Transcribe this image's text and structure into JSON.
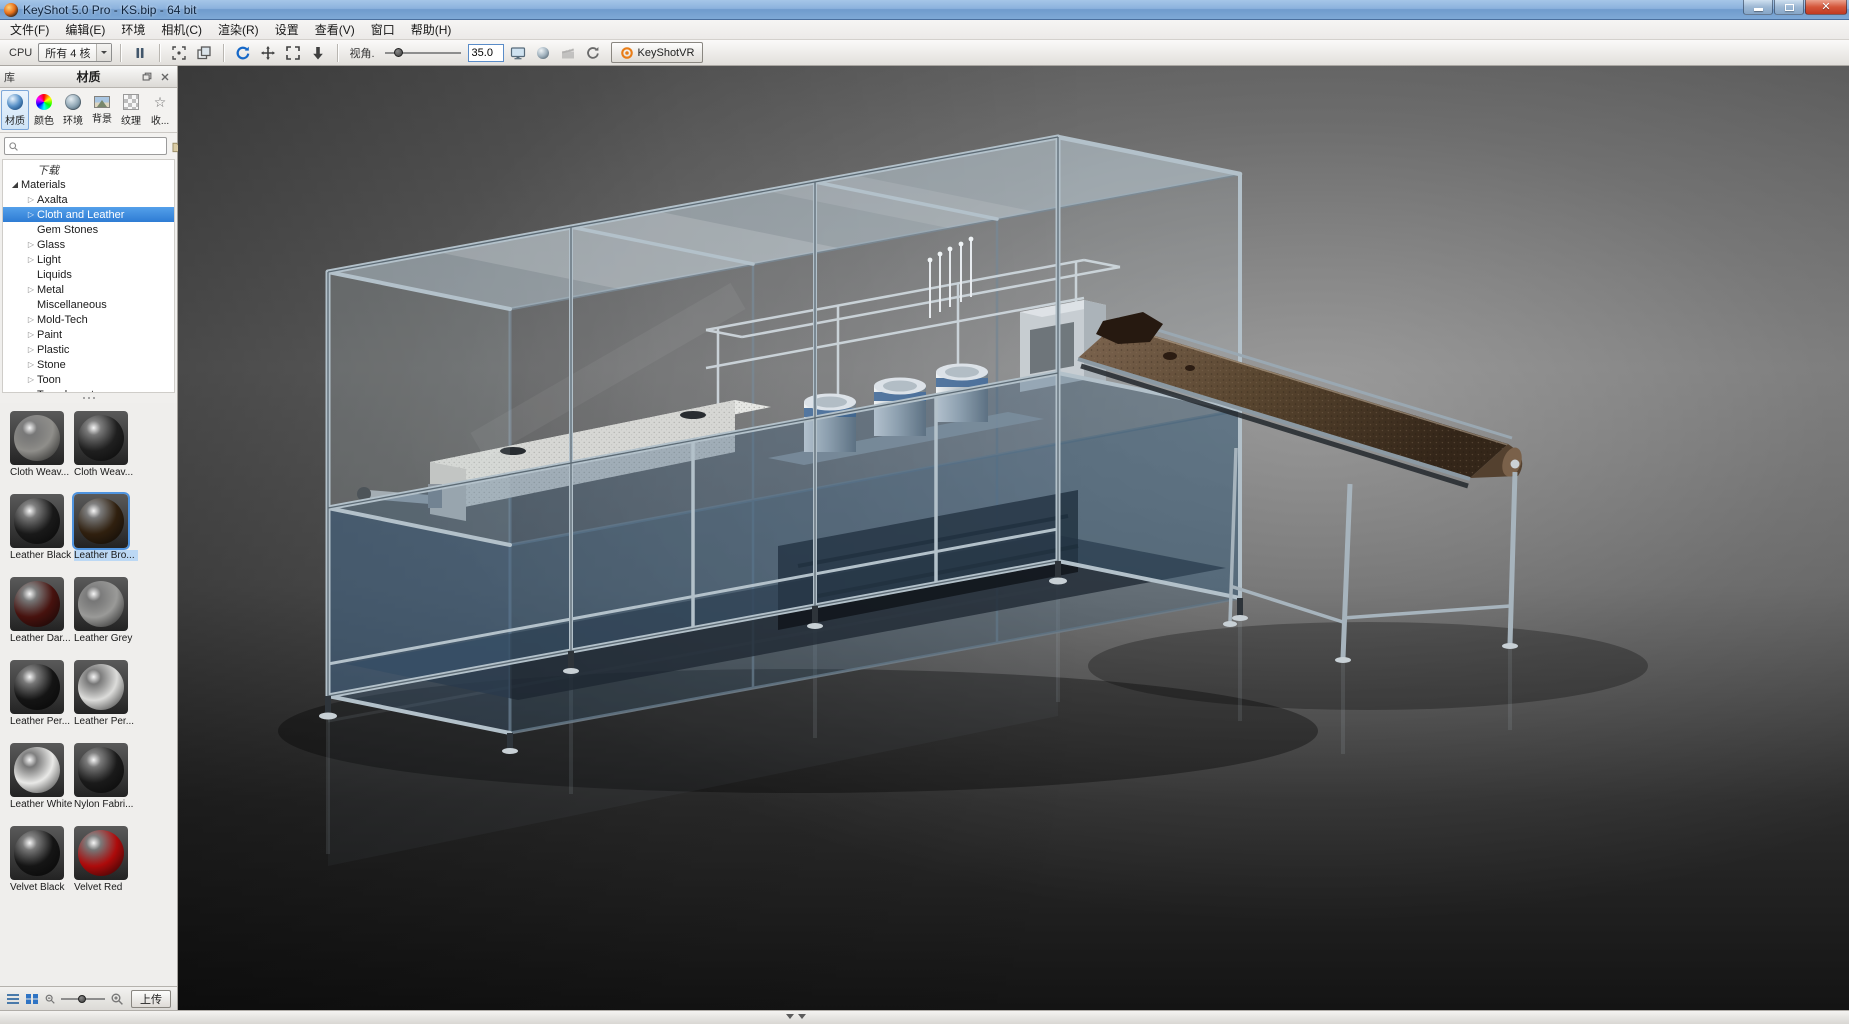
{
  "window": {
    "title": "KeyShot 5.0 Pro  - KS.bip  - 64 bit"
  },
  "menu_bar": {
    "items": [
      {
        "label": "文件(F)"
      },
      {
        "label": "编辑(E)"
      },
      {
        "label": "环境"
      },
      {
        "label": "相机(C)"
      },
      {
        "label": "渲染(R)"
      },
      {
        "label": "设置"
      },
      {
        "label": "查看(V)"
      },
      {
        "label": "窗口"
      },
      {
        "label": "帮助(H)"
      }
    ]
  },
  "toolbar": {
    "cpu_label": "CPU",
    "cores_dropdown": "所有 4 核",
    "fov_label": "视角.",
    "fov_value": "35.0",
    "vr_button_label": "KeyShotVR"
  },
  "library_panel": {
    "panel_label": "库",
    "panel_title": "材质",
    "tabs": [
      {
        "label": "材质",
        "icon": "material-sphere",
        "active": true
      },
      {
        "label": "颜色",
        "icon": "color-wheel",
        "active": false
      },
      {
        "label": "环境",
        "icon": "environment-globe",
        "active": false
      },
      {
        "label": "背景",
        "icon": "backplate-image",
        "active": false
      },
      {
        "label": "纹理",
        "icon": "texture-checker",
        "active": false
      },
      {
        "label": "收...",
        "icon": "favorites-star",
        "active": false
      }
    ],
    "search": {
      "value": "",
      "placeholder": ""
    },
    "tree": {
      "downloads_label": "下载",
      "root_label": "Materials",
      "items": [
        {
          "label": "Axalta",
          "expandable": true,
          "selected": false
        },
        {
          "label": "Cloth and Leather",
          "expandable": true,
          "selected": true
        },
        {
          "label": "Gem Stones",
          "expandable": false,
          "selected": false
        },
        {
          "label": "Glass",
          "expandable": true,
          "selected": false
        },
        {
          "label": "Light",
          "expandable": true,
          "selected": false
        },
        {
          "label": "Liquids",
          "expandable": false,
          "selected": false
        },
        {
          "label": "Metal",
          "expandable": true,
          "selected": false
        },
        {
          "label": "Miscellaneous",
          "expandable": false,
          "selected": false
        },
        {
          "label": "Mold-Tech",
          "expandable": true,
          "selected": false
        },
        {
          "label": "Paint",
          "expandable": true,
          "selected": false
        },
        {
          "label": "Plastic",
          "expandable": true,
          "selected": false
        },
        {
          "label": "Stone",
          "expandable": true,
          "selected": false
        },
        {
          "label": "Toon",
          "expandable": true,
          "selected": false
        },
        {
          "label": "Translucent",
          "expandable": false,
          "selected": false
        }
      ]
    },
    "materials": [
      {
        "label": "Cloth Weav...",
        "color": "#8f8e8a",
        "selected": false
      },
      {
        "label": "Cloth Weav...",
        "color": "#1f1f1f",
        "selected": false
      },
      {
        "label": "Leather Black",
        "color": "#191919",
        "selected": false
      },
      {
        "label": "Leather Bro...",
        "color": "#30200f",
        "selected": true
      },
      {
        "label": "Leather Dar...",
        "color": "#47120e",
        "selected": false
      },
      {
        "label": "Leather Grey",
        "color": "#9a9a98",
        "selected": false
      },
      {
        "label": "Leather Per...",
        "color": "#141414",
        "selected": false
      },
      {
        "label": "Leather Per...",
        "color": "#dcdcda",
        "selected": false
      },
      {
        "label": "Leather White",
        "color": "#e9e9e7",
        "selected": false
      },
      {
        "label": "Nylon Fabri...",
        "color": "#1a1a1a",
        "selected": false
      },
      {
        "label": "Velvet Black",
        "color": "#151515",
        "selected": false
      },
      {
        "label": "Velvet Red",
        "color": "#ad0b0b",
        "selected": false
      }
    ],
    "footer": {
      "upload_label": "上传"
    }
  }
}
